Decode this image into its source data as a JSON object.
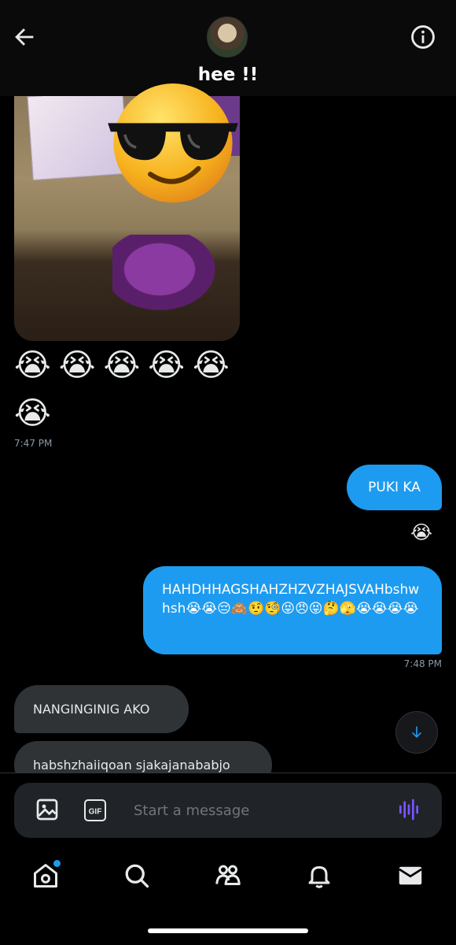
{
  "header": {
    "contact_name": "hee !!"
  },
  "messages": {
    "emoji_row1": "😭😭😭😭😭",
    "emoji_row2": "😭",
    "timestamp1": "7:47 PM",
    "sent_puki": "PUKI KA",
    "reaction": "😭",
    "sent_long": "HAHDHHAGSHAHZHZVZHAJSVAHbshwhsh😭😭😔🙈🤨🧐😝😠😝🤔🫣😭😭😭😭",
    "timestamp2": "7:48 PM",
    "recv_1": "NANGINGINIG AKO",
    "recv_2": "habshzhaiiqoan sjakajanababjo"
  },
  "composer": {
    "placeholder": "Start a message",
    "gif_label": "GIF"
  },
  "colors": {
    "accent": "#1d9bf0",
    "voice": "#7856ff",
    "incoming_bubble": "#2f3336"
  },
  "icons": [
    "back-arrow-icon",
    "info-icon",
    "image-icon",
    "gif-icon",
    "voice-wave-icon",
    "home-icon",
    "search-icon",
    "communities-icon",
    "notifications-icon",
    "messages-icon",
    "chevron-down-icon"
  ]
}
